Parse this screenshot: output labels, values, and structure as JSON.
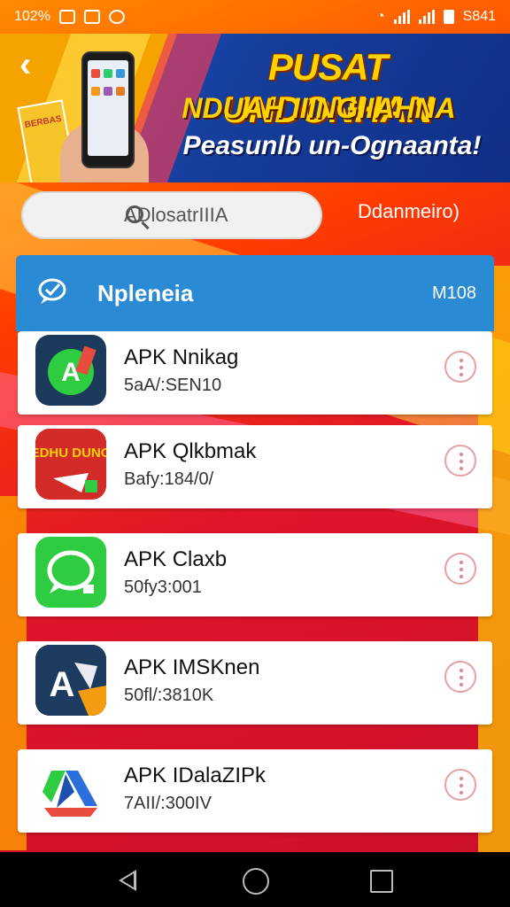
{
  "status_bar": {
    "battery_percent": "102%",
    "time": "S841"
  },
  "banner": {
    "title_line1": "PUSAT UNDONHAN",
    "title_line2": "NDUAH IIINGIIAHNA",
    "title_line3": "Peasunlb un-Ognaanta!",
    "bag_label": "BERBAS"
  },
  "search": {
    "placeholder": "ADlosatrIIIA"
  },
  "download_link": "Ddanmeiro)",
  "panel": {
    "title": "Npleneia",
    "count": "M108"
  },
  "apps": [
    {
      "name": "APK Nnikag",
      "meta": "5aA/:SEN10",
      "icon": "android-app-icon",
      "color": "#1b3a5c"
    },
    {
      "name": "APK Qlkbmak",
      "meta": "Bafy:184/0/",
      "icon": "game-app-icon",
      "color": "#d32a2a",
      "icon_text": "DEDHU DUNOA"
    },
    {
      "name": "APK Claxb",
      "meta": "50fy3:001",
      "icon": "chat-app-icon",
      "color": "#2ecc40"
    },
    {
      "name": "APK IMSKnen",
      "meta": "50fl/:3810K",
      "icon": "shield-app-icon",
      "color": "#1d3b5e"
    },
    {
      "name": "APK IDalaZIPk",
      "meta": "7AII/:300IV",
      "icon": "drive-app-icon",
      "color": "#ffffff"
    }
  ]
}
